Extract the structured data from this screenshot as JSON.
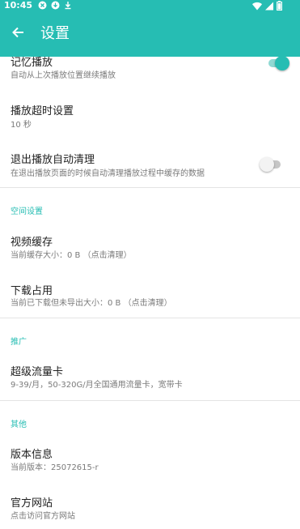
{
  "status_bar": {
    "time": "10:45",
    "left_icons": [
      "notification-icon",
      "download-icon",
      "download-arrow-icon"
    ],
    "right_icons": [
      "wifi-icon",
      "cellular-signal-icon",
      "battery-icon"
    ]
  },
  "app_bar": {
    "back_icon": "arrow-left-icon",
    "title": "设置"
  },
  "colors": {
    "accent": "#26bdb3",
    "toggle_on_track": "#8fd9d3",
    "subtitle_text": "#7a7a7a",
    "divider": "#e4e4e4"
  },
  "settings": {
    "resume_playback": {
      "title": "记忆播放",
      "subtitle": "自动从上次播放位置继续播放",
      "toggle_on": true
    },
    "playback_timeout": {
      "title": "播放超时设置",
      "subtitle": "10 秒"
    },
    "auto_clean_on_exit": {
      "title": "退出播放自动清理",
      "subtitle": "在退出播放页面的时候自动清理播放过程中缓存的数据",
      "toggle_on": false
    },
    "storage_section": {
      "header": "空间设置"
    },
    "video_cache": {
      "title": "视频缓存",
      "subtitle": "当前缓存大小：0 B （点击清理）"
    },
    "download_usage": {
      "title": "下载占用",
      "subtitle": "当前已下载但未导出大小：0 B （点击清理）"
    },
    "promo_section": {
      "header": "推广"
    },
    "super_data_card": {
      "title": "超级流量卡",
      "subtitle": "9-39/月，50-320G/月全国通用流量卡，宽带卡"
    },
    "other_section": {
      "header": "其他"
    },
    "version_info": {
      "title": "版本信息",
      "subtitle": "当前版本：25072615-r"
    },
    "official_website": {
      "title": "官方网站",
      "subtitle": "点击访问官方网站"
    }
  }
}
